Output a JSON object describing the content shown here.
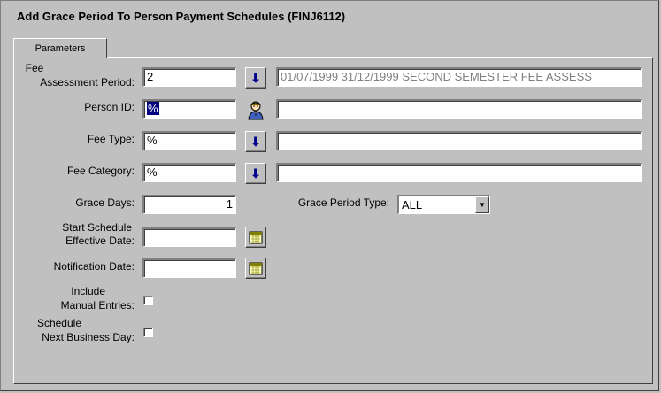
{
  "window": {
    "title": "Add Grace Period To Person Payment Schedules (FINJ6112)"
  },
  "tabs": [
    {
      "label": "Parameters"
    }
  ],
  "form": {
    "fee_period": {
      "label_line1": "Fee",
      "label_line2": "Assessment Period:",
      "value": "2",
      "description": "01/07/1999 31/12/1999 SECOND SEMESTER FEE ASSESS",
      "lookup_icon": "down-arrow-icon"
    },
    "person_id": {
      "label": "Person ID:",
      "value": "%",
      "description": "",
      "lookup_icon": "person-icon"
    },
    "fee_type": {
      "label": "Fee Type:",
      "value": "%",
      "description": "",
      "lookup_icon": "down-arrow-icon"
    },
    "fee_category": {
      "label": "Fee Category:",
      "value": "%",
      "description": "",
      "lookup_icon": "down-arrow-icon"
    },
    "grace_days": {
      "label": "Grace Days:",
      "value": "1"
    },
    "grace_period_type": {
      "label": "Grace Period Type:",
      "value": "ALL"
    },
    "start_schedule_date": {
      "label_line1": "Start Schedule",
      "label_line2": "Effective Date:",
      "value": "",
      "calendar_icon": "calendar-icon"
    },
    "notification_date": {
      "label": "Notification Date:",
      "value": "",
      "calendar_icon": "calendar-icon"
    },
    "include_manual": {
      "label_line1": "Include",
      "label_line2": "Manual Entries:",
      "checked": false
    },
    "schedule_next_business_day": {
      "label_line1": "Schedule",
      "label_line2": "Next Business Day:",
      "checked": false
    }
  },
  "colors": {
    "background": "#c0c0c0",
    "selection": "#000080",
    "arrow": "#00008b"
  }
}
